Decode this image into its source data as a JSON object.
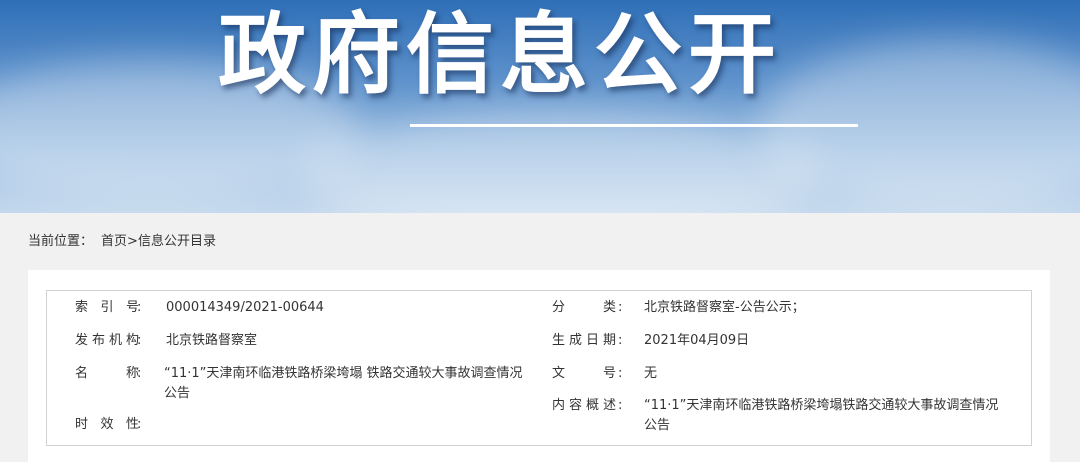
{
  "banner": {
    "title": "政府信息公开"
  },
  "breadcrumb": {
    "prefix": "当前位置：",
    "home": "首页",
    "separator": ">",
    "current": "信息公开目录"
  },
  "info": {
    "index_no": {
      "label": "索引号",
      "value": "000014349/2021-00644"
    },
    "category": {
      "label": "分类",
      "value": "北京铁路督察室-公告公示；"
    },
    "publisher": {
      "label": "发布机构",
      "value": "北京铁路督察室"
    },
    "date": {
      "label": "生成日期",
      "value": "2021年04月09日"
    },
    "name": {
      "label": "名称",
      "value": "“11·1”天津南环临港铁路桥梁垮塌 铁路交通较大事故调查情况公告"
    },
    "doc_no": {
      "label": "文号",
      "value": "无"
    },
    "summary": {
      "label": "内容概述",
      "value": "“11·1”天津南环临港铁路桥梁垮塌铁路交通较大事故调查情况公告"
    },
    "validity": {
      "label": "时效性",
      "value": ""
    }
  },
  "colors": {
    "banner_top": "#2f6fb7",
    "page_bg": "#f1f1f1",
    "border": "#d2d2d2"
  }
}
